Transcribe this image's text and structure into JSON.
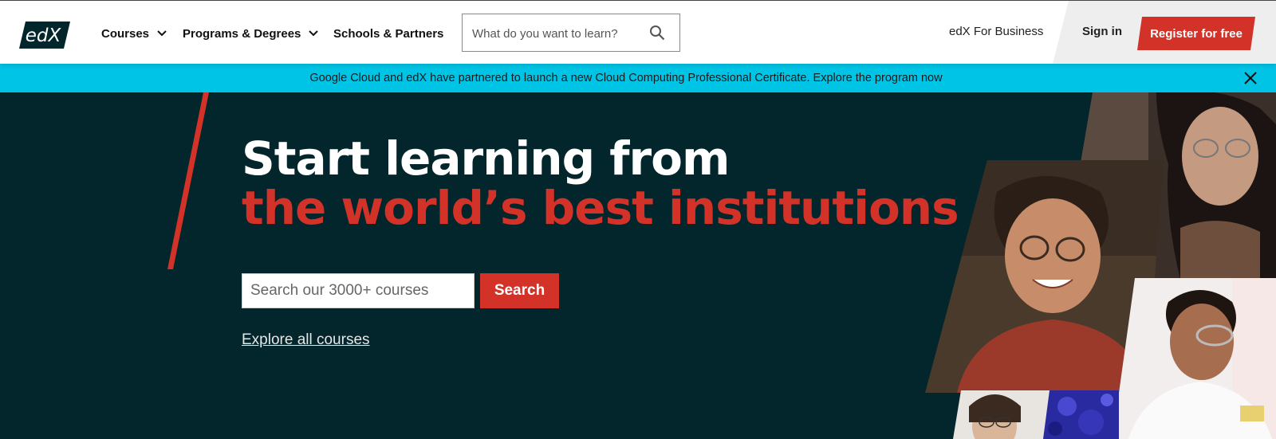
{
  "header": {
    "logo_text": "edX",
    "nav": [
      {
        "label": "Courses",
        "has_dropdown": true
      },
      {
        "label": "Programs & Degrees",
        "has_dropdown": true
      },
      {
        "label": "Schools & Partners",
        "has_dropdown": false
      }
    ],
    "search_placeholder": "What do you want to learn?",
    "business_link": "edX For Business",
    "signin_label": "Sign in",
    "register_label": "Register for free"
  },
  "banner": {
    "text": "Google Cloud and edX have partnered to launch a new Cloud Computing Professional Certificate. Explore the program now",
    "close_icon": "close-icon"
  },
  "hero": {
    "title_line1": "Start learning from",
    "title_line2": "the world’s best institutions",
    "search_placeholder": "Search our 3000+ courses",
    "search_button": "Search",
    "explore_link": "Explore all courses"
  },
  "colors": {
    "brand_red": "#d23228",
    "hero_bg": "#02262b",
    "banner_bg": "#00c4e6",
    "logo_bg": "#02262b"
  }
}
